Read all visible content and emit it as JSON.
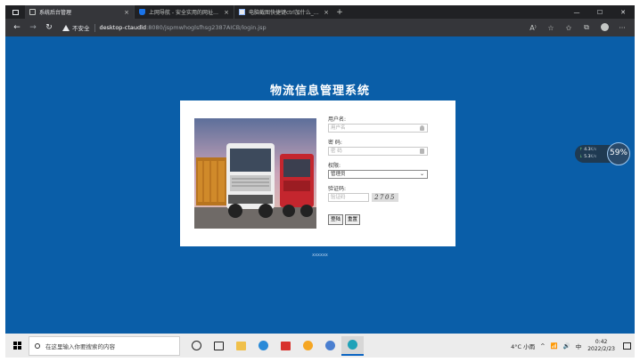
{
  "browser": {
    "tabs": [
      {
        "title": "系统后台管理",
        "active": true
      },
      {
        "title": "上网导航 - 安全实用的网址导航",
        "active": false
      },
      {
        "title": "电脑截图快捷键ctrl加什么_百度",
        "active": false
      }
    ],
    "close_glyph": "×",
    "new_tab_glyph": "+",
    "window_controls": {
      "minimize": "—",
      "maximize": "☐",
      "close": "✕"
    },
    "nav": {
      "back": "←",
      "forward": "→",
      "refresh": "↻"
    },
    "address": {
      "security_label": "不安全",
      "host": "desktop-ctaudld",
      "path": ":8080/jspmwhoglsfhsg2387AICB/login.jsp"
    },
    "toolbar_icons": [
      "read-aloud-icon",
      "favorites-add-icon",
      "favorites-icon",
      "collections-icon",
      "profile-icon",
      "more-icon"
    ],
    "toolbar_glyphs": {
      "read_aloud": "A⁾",
      "favorite_add": "☆",
      "favorites": "✩",
      "collections": "⧉",
      "more": "···"
    }
  },
  "page": {
    "background": "#0a5ea8",
    "title": "物流信息管理系统",
    "form": {
      "username_label": "用户名:",
      "username_placeholder": "用户名",
      "password_label": "密 码:",
      "password_placeholder": "密  码",
      "role_label": "权限:",
      "role_selected": "管理员",
      "captcha_label": "验证码:",
      "captcha_placeholder": "验证码",
      "captcha_text": "2705",
      "login_button": "登陆",
      "reset_button": "重置"
    },
    "footer": "xxxxxx"
  },
  "net_widget": {
    "upload": "4.3",
    "upload_unit": "K/s",
    "download": "5.3",
    "download_unit": "K/s",
    "percent": "59%",
    "up_arrow": "↑",
    "down_arrow": "↓"
  },
  "taskbar": {
    "search_placeholder": "在这里输入你要搜索的内容",
    "apps": [
      "cortana-icon",
      "task-view-icon",
      "file-explorer-icon",
      "ie-icon",
      "wps-icon",
      "weather-app-icon",
      "chrome-icon",
      "edge-icon"
    ],
    "weather": "4°C 小雨",
    "tray_glyphs": {
      "chevron": "^",
      "network": "📶",
      "volume": "🔊"
    },
    "ime": "中",
    "time": "0:42",
    "date": "2022/2/23"
  }
}
